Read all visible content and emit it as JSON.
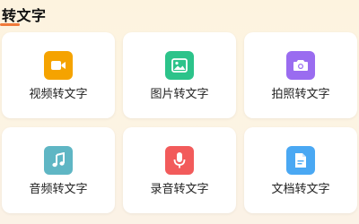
{
  "section": {
    "title": "转文字"
  },
  "cards": [
    {
      "label": "视频转文字",
      "icon": "video-camera-icon",
      "color": "#f5a300"
    },
    {
      "label": "图片转文字",
      "icon": "image-icon",
      "color": "#2cc38a"
    },
    {
      "label": "拍照转文字",
      "icon": "camera-icon",
      "color": "#9a6cf0"
    },
    {
      "label": "音频转文字",
      "icon": "music-note-icon",
      "color": "#5fb6c4"
    },
    {
      "label": "录音转文字",
      "icon": "microphone-icon",
      "color": "#f25b5b"
    },
    {
      "label": "文档转文字",
      "icon": "document-icon",
      "color": "#4aa8f3"
    }
  ],
  "colors": {
    "title_underline": "#f07a3a",
    "card_background": "#ffffff"
  }
}
